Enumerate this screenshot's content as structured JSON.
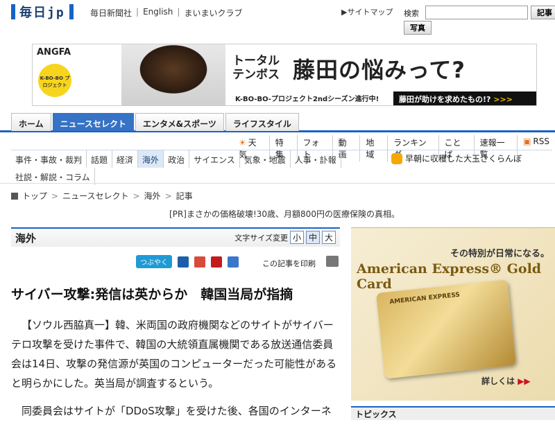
{
  "header": {
    "logo": "毎日jp",
    "links": [
      "毎日新聞社",
      "English",
      "まいまいクラブ"
    ],
    "sitemap": "サイトマップ",
    "search_label": "検索",
    "search_placeholder": "",
    "search_button": "記事",
    "photo_button": "写真"
  },
  "banner": {
    "brand": "ANGFA",
    "badge": "K-BO-BO プロジェクト",
    "left_line1": "トータル",
    "left_line2": "テンボス",
    "headline": "藤田の悩みって?",
    "sub": "K-BO-BO-プロジェクト2ndシーズン進行中!",
    "cta": "藤田が助けを求めたもの!?"
  },
  "nav": {
    "items": [
      "ホーム",
      "ニュースセレクト",
      "エンタメ&スポーツ",
      "ライフスタイル"
    ],
    "active": "ニュースセレクト"
  },
  "subnav": {
    "items": [
      "天気",
      "特集",
      "フォト",
      "動画",
      "地域",
      "ランキング",
      "ことば",
      "速報一覧",
      "RSS"
    ]
  },
  "categories": {
    "row1": [
      "事件・事故・裁判",
      "話題",
      "経済",
      "海外",
      "政治",
      "サイエンス",
      "気象・地震",
      "人事・訃報"
    ],
    "row2": [
      "社説・解説・コラム"
    ],
    "active": "海外",
    "topic_link": "早朝に収穫した大玉さくらんぼ"
  },
  "breadcrumb": [
    "トップ",
    "ニュースセレクト",
    "海外",
    "記事"
  ],
  "pr": "[PR]まさかの価格破壊!30歳、月額800円の医療保険の真相。",
  "article": {
    "section": "海外",
    "fontsize_label": "文字サイズ変更",
    "fontsize_options": [
      "小",
      "中",
      "大"
    ],
    "tweet_label": "つぶやく",
    "print_label": "この記事を印刷",
    "headline": "サイバー攻撃:発信は英からか　韓国当局が指摘",
    "para1": "【ソウル西脇真一】韓、米両国の政府機関などのサイトがサイバーテロ攻撃を受けた事件で、韓国の大統領直属機関である放送通信委員会は14日、攻撃の発信源が英国のコンピューターだった可能性があると明らかにした。英当局が調査するという。",
    "para2": "同委員会はサイトが「DDoS攻撃」を受けた後、各国のインターネ"
  },
  "side_ad": {
    "sub": "その特別が日常になる。",
    "title": "American Express® Gold Card",
    "card_name": "AMERICAN EXPRESS",
    "more": "詳しくは",
    "more_arrow": "▶▶"
  },
  "topics": "トピックス"
}
